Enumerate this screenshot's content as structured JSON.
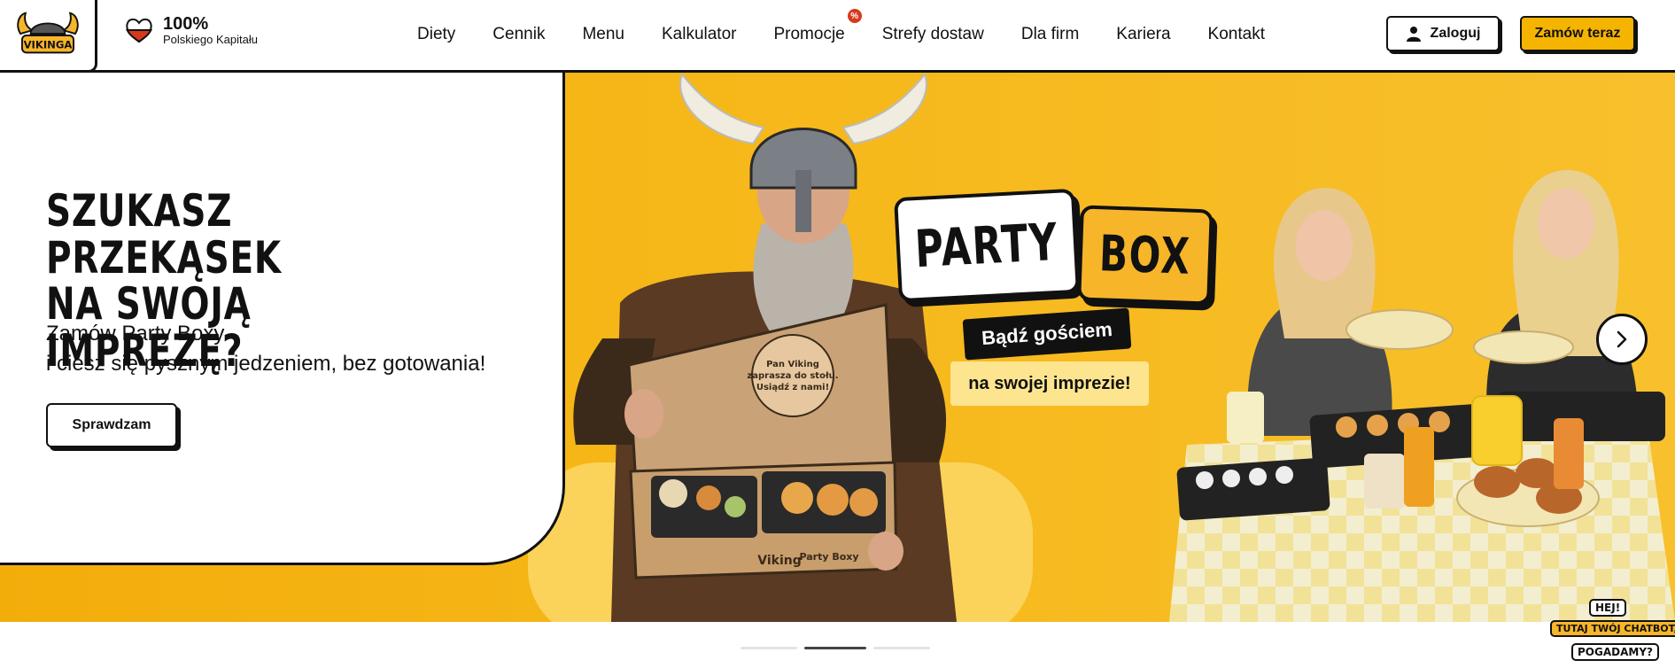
{
  "header": {
    "logo_text": "VIKINGA",
    "capital": {
      "percent": "100%",
      "label": "Polskiego Kapitału"
    },
    "nav": [
      {
        "label": "Diety"
      },
      {
        "label": "Cennik"
      },
      {
        "label": "Menu"
      },
      {
        "label": "Kalkulator"
      },
      {
        "label": "Promocje",
        "badge": "%"
      },
      {
        "label": "Strefy dostaw"
      },
      {
        "label": "Dla firm"
      },
      {
        "label": "Kariera"
      },
      {
        "label": "Kontakt"
      }
    ],
    "login_label": "Zaloguj",
    "order_label": "Zamów teraz"
  },
  "hero": {
    "title_line1": "SZUKASZ PRZEKĄSEK",
    "title_line2": "NA SWOJĄ IMPREZĘ?",
    "subtitle_line1": "Zamów Party Boxy",
    "subtitle_line2": "i ciesz się pysznym jedzeniem, bez gotowania!",
    "cta_label": "Sprawdzam",
    "sticker": {
      "party": "PARTY",
      "box": "BOX",
      "guest": "Bądź gościem",
      "party2": "na swojej imprezie!"
    },
    "box_print": {
      "line1": "Pan Viking",
      "line2": "zaprasza do stołu.",
      "line3": "Usiądź z nami!",
      "brand": "Viking",
      "label": "Party Boxy"
    },
    "next_icon": "chevron-right-icon"
  },
  "slider": {
    "slide_count": 3,
    "active_index": 1
  },
  "chatbot": {
    "line1": "HEJ!",
    "line2": "TUTAJ TWÓJ CHATBOT,",
    "line3": "POGADAMY?"
  },
  "colors": {
    "accent": "#f5b400",
    "ink": "#111111",
    "red": "#d63a1e"
  }
}
